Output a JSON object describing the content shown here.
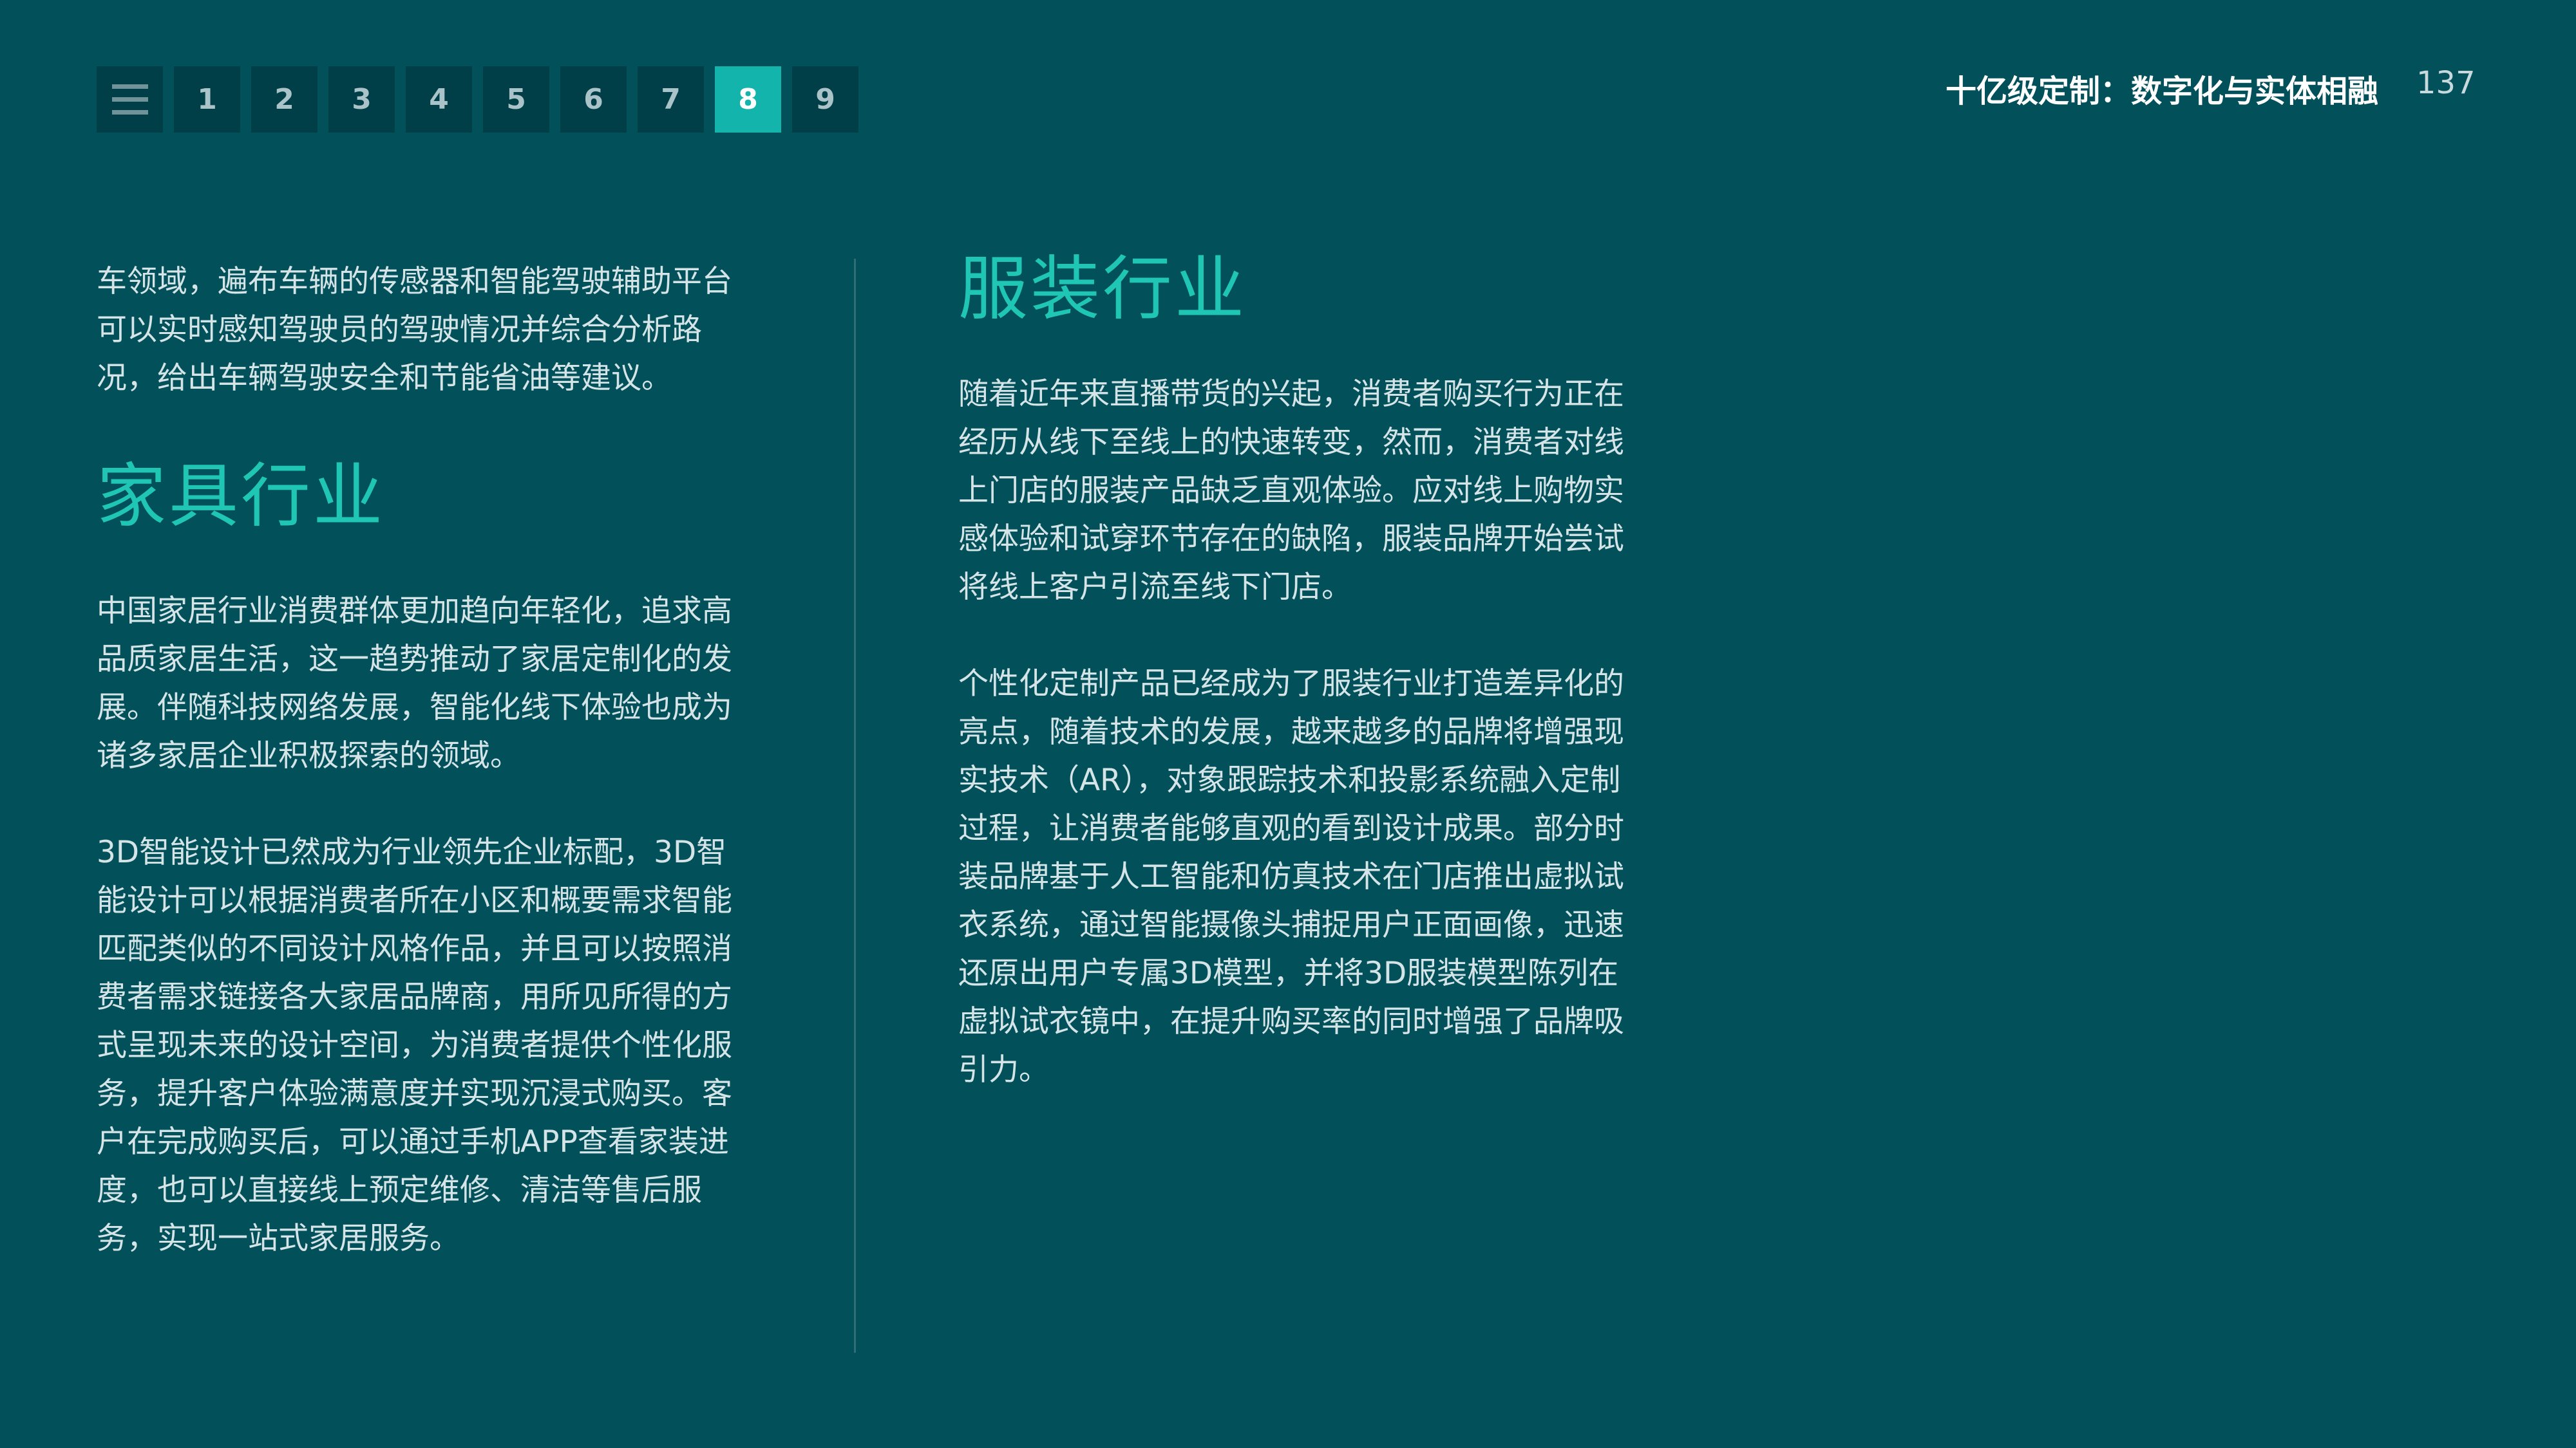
{
  "nav": {
    "menu_icon": "menu-icon",
    "pages": [
      "1",
      "2",
      "3",
      "4",
      "5",
      "6",
      "7",
      "8",
      "9"
    ],
    "active_page": "8"
  },
  "header": {
    "title": "十亿级定制：数字化与实体相融",
    "page_number": "137"
  },
  "left": {
    "intro": "车领域，遍布车辆的传感器和智能驾驶辅助平台可以实时感知驾驶员的驾驶情况并综合分析路况，给出车辆驾驶安全和节能省油等建议。",
    "heading": "家具行业",
    "para1": "中国家居行业消费群体更加趋向年轻化，追求高品质家居生活，这一趋势推动了家居定制化的发展。伴随科技网络发展，智能化线下体验也成为诸多家居企业积极探索的领域。",
    "para2": "3D智能设计已然成为行业领先企业标配，3D智能设计可以根据消费者所在小区和概要需求智能匹配类似的不同设计风格作品，并且可以按照消费者需求链接各大家居品牌商，用所见所得的方式呈现未来的设计空间，为消费者提供个性化服务，提升客户体验满意度并实现沉浸式购买。客户在完成购买后，可以通过手机APP查看家装进度，也可以直接线上预定维修、清洁等售后服务，实现一站式家居服务。"
  },
  "right": {
    "heading": "服装行业",
    "para1": "随着近年来直播带货的兴起，消费者购买行为正在经历从线下至线上的快速转变，然而，消费者对线上门店的服装产品缺乏直观体验。应对线上购物实感体验和试穿环节存在的缺陷，服装品牌开始尝试将线上客户引流至线下门店。",
    "para2": "个性化定制产品已经成为了服装行业打造差异化的亮点，随着技术的发展，越来越多的品牌将增强现实技术（AR），对象跟踪技术和投影系统融入定制过程，让消费者能够直观的看到设计成果。部分时装品牌基于人工智能和仿真技术在门店推出虚拟试衣系统，通过智能摄像头捕捉用户正面画像，迅速还原出用户专属3D模型，并将3D服装模型陈列在虚拟试衣镜中，在提升购买率的同时增强了品牌吸引力。"
  },
  "colors": {
    "background": "#02505a",
    "nav_button": "#013f48",
    "nav_active": "#13b4ac",
    "heading": "#1fc6b4",
    "body_text": "#d4e4e7",
    "divider": "#2f6e76"
  }
}
